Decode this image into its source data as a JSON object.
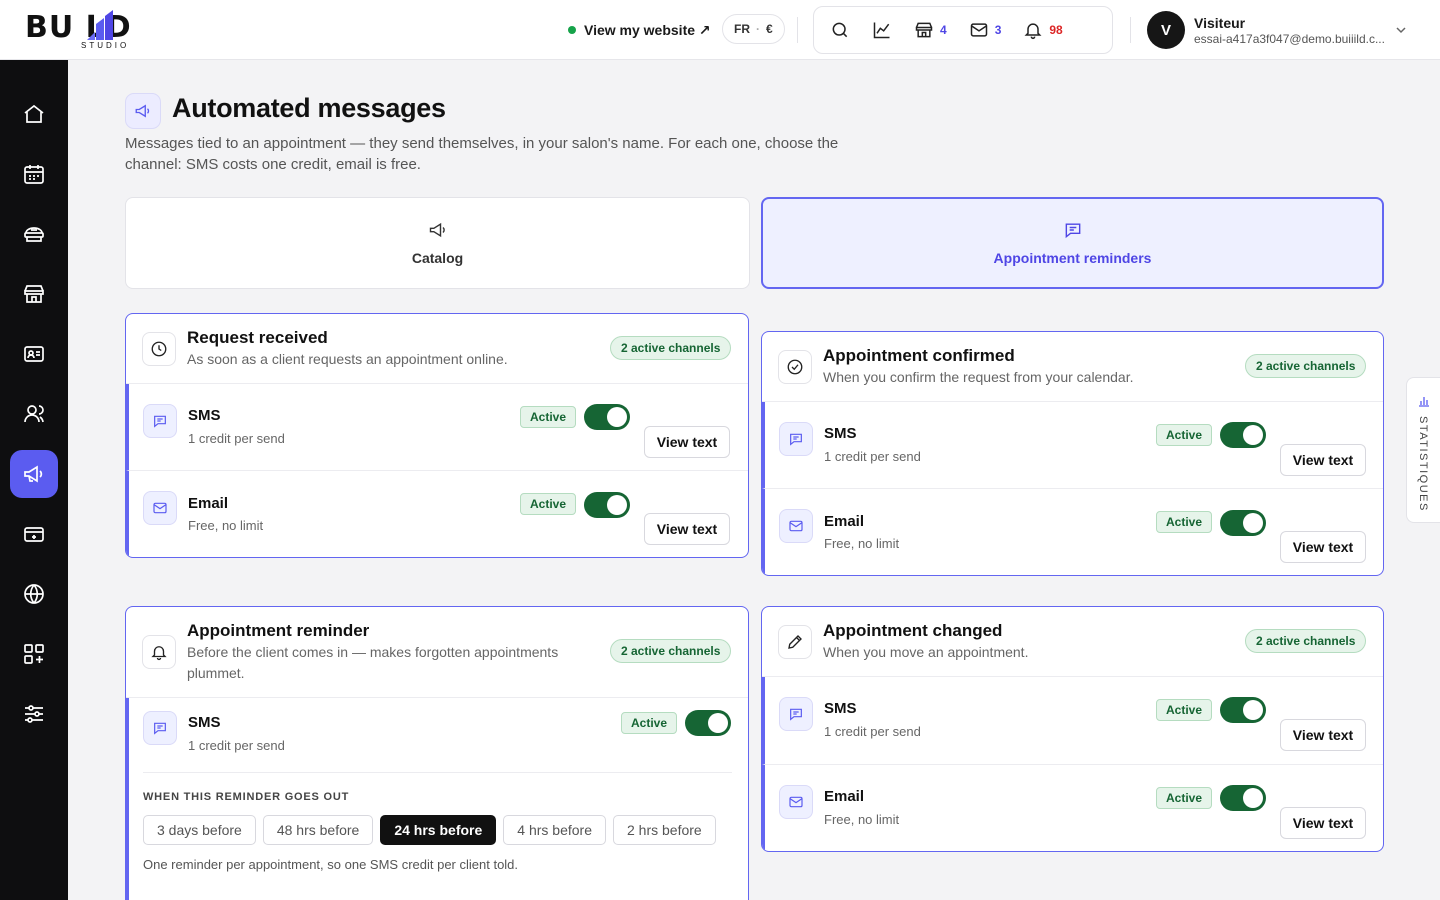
{
  "brand": {
    "word": "BU LD",
    "studio": "STUDIO"
  },
  "topbar": {
    "view_site": "View my website ↗",
    "lang": "FR",
    "currency": "€",
    "counts": {
      "shop": "4",
      "mail": "3",
      "bell": "98"
    },
    "user": {
      "initial": "V",
      "name": "Visiteur",
      "email": "essai-a417a3f047@demo.buiiild.c..."
    }
  },
  "sidebar": {
    "items": [
      "home-icon",
      "calendar-icon",
      "services-icon",
      "shop-icon",
      "id-card-icon",
      "clients-icon",
      "megaphone-icon",
      "payments-icon",
      "globe-icon",
      "apps-icon",
      "settings-icon"
    ],
    "active_index": 6
  },
  "page": {
    "title": "Automated messages",
    "description": "Messages tied to an appointment — they send themselves, in your salon's name. For each one, choose the channel: SMS costs one credit, email is free."
  },
  "tabs": [
    {
      "label": "Catalog",
      "icon": "megaphone-icon",
      "active": false
    },
    {
      "label": "Appointment reminders",
      "icon": "chat-icon",
      "active": true
    }
  ],
  "common": {
    "active": "Active",
    "view_text": "View text",
    "sms": "SMS",
    "sms_sub": "1 credit per send",
    "email": "Email",
    "email_sub": "Free, no limit"
  },
  "events": {
    "request": {
      "title": "Request received",
      "subtitle": "As soon as a client requests an appointment online.",
      "pill": "2 active channels"
    },
    "confirmed": {
      "title": "Appointment confirmed",
      "subtitle": "When you confirm the request from your calendar.",
      "pill": "2 active channels"
    },
    "reminder": {
      "title": "Appointment reminder",
      "subtitle": "Before the client comes in — makes forgotten appointments plummet.",
      "pill": "2 active channels",
      "timing_label": "WHEN THIS REMINDER GOES OUT",
      "options": [
        "3 days before",
        "48 hrs before",
        "24 hrs before",
        "4 hrs before",
        "2 hrs before"
      ],
      "selected_option": "24 hrs before",
      "note": "One reminder per appointment, so one SMS credit per client told."
    },
    "changed": {
      "title": "Appointment changed",
      "subtitle": "When you move an appointment.",
      "pill": "2 active channels"
    }
  },
  "stats_tab": "STATISTIQUES",
  "colors": {
    "accent": "#6366f1",
    "active_green": "#166534",
    "sidebar_bg": "#0e0e10"
  }
}
